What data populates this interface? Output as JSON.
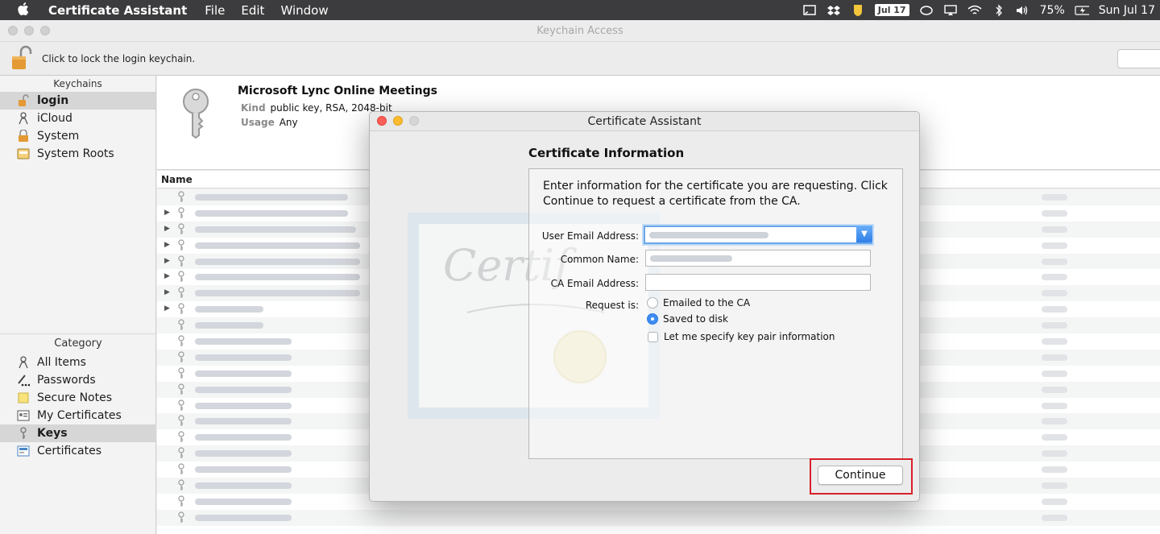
{
  "menubar": {
    "app_name": "Certificate Assistant",
    "menus": [
      "File",
      "Edit",
      "Window"
    ],
    "status": {
      "date_badge": "Jul 17",
      "battery": "75%",
      "clock": "Sun Jul 17"
    }
  },
  "window": {
    "title": "Keychain Access",
    "lock_text": "Click to lock the login keychain."
  },
  "sidebar": {
    "keychains_header": "Keychains",
    "keychains": [
      {
        "label": "login",
        "icon": "unlocked-padlock-icon",
        "selected": true
      },
      {
        "label": "iCloud",
        "icon": "cloud-person-icon",
        "selected": false
      },
      {
        "label": "System",
        "icon": "padlock-icon",
        "selected": false
      },
      {
        "label": "System Roots",
        "icon": "folder-cabinet-icon",
        "selected": false
      }
    ],
    "category_header": "Category",
    "categories": [
      {
        "label": "All Items",
        "icon": "all-items-icon",
        "selected": false
      },
      {
        "label": "Passwords",
        "icon": "pen-dots-icon",
        "selected": false
      },
      {
        "label": "Secure Notes",
        "icon": "note-icon",
        "selected": false
      },
      {
        "label": "My Certificates",
        "icon": "my-certificate-icon",
        "selected": false
      },
      {
        "label": "Keys",
        "icon": "key-icon",
        "selected": true
      },
      {
        "label": "Certificates",
        "icon": "certificate-icon",
        "selected": false
      }
    ]
  },
  "info": {
    "title": "Microsoft Lync Online Meetings",
    "kind_label": "Kind",
    "kind_value": "public key, RSA, 2048-bit",
    "usage_label": "Usage",
    "usage_value": "Any"
  },
  "list": {
    "column_name": "Name"
  },
  "dialog": {
    "window_title": "Certificate Assistant",
    "heading": "Certificate Information",
    "intro": "Enter information for the certificate you are requesting. Click Continue to request a certificate from the CA.",
    "fields": {
      "user_email_label": "User Email Address:",
      "common_name_label": "Common Name:",
      "ca_email_label": "CA Email Address:",
      "request_is_label": "Request is:"
    },
    "options": {
      "emailed": "Emailed to the CA",
      "saved": "Saved to disk",
      "specify": "Let me specify key pair information"
    },
    "selected_option": "Saved to disk",
    "continue_label": "Continue",
    "colors": {
      "highlight": "#d8202a",
      "accent": "#3b8cf3"
    }
  }
}
